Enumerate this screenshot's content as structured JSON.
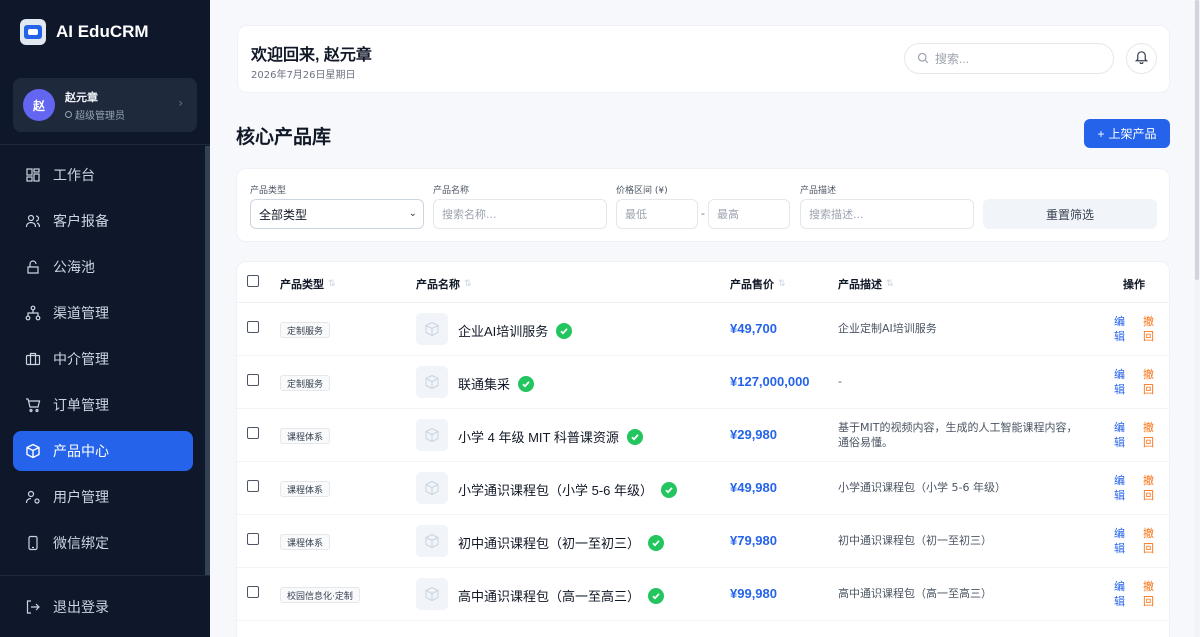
{
  "app": {
    "title": "AI EduCRM"
  },
  "user": {
    "name": "赵元章",
    "initial": "赵",
    "role": "超级管理员"
  },
  "nav": [
    {
      "label": "工作台",
      "icon": "dashboard-icon",
      "active": false
    },
    {
      "label": "客户报备",
      "icon": "users-icon",
      "active": false
    },
    {
      "label": "公海池",
      "icon": "pool-icon",
      "active": false
    },
    {
      "label": "渠道管理",
      "icon": "channel-icon",
      "active": false
    },
    {
      "label": "中介管理",
      "icon": "briefcase-icon",
      "active": false
    },
    {
      "label": "订单管理",
      "icon": "cart-icon",
      "active": false
    },
    {
      "label": "产品中心",
      "icon": "package-icon",
      "active": true
    },
    {
      "label": "用户管理",
      "icon": "user-cog-icon",
      "active": false
    },
    {
      "label": "微信绑定",
      "icon": "phone-icon",
      "active": false
    }
  ],
  "logout_label": "退出登录",
  "header": {
    "greeting": "欢迎回来, 赵元章",
    "date": "2026年7月26日星期日",
    "search_placeholder": "搜索..."
  },
  "page": {
    "title": "核心产品库",
    "add_button": "上架产品"
  },
  "filters": {
    "type_label": "产品类型",
    "type_value": "全部类型",
    "name_label": "产品名称",
    "name_placeholder": "搜索名称...",
    "price_label": "价格区间 (¥)",
    "price_min_placeholder": "最低",
    "price_max_placeholder": "最高",
    "price_sep": "-",
    "desc_label": "产品描述",
    "desc_placeholder": "搜索描述...",
    "reset": "重置筛选"
  },
  "table": {
    "columns": {
      "type": "产品类型",
      "name": "产品名称",
      "price": "产品售价",
      "desc": "产品描述",
      "actions": "操作"
    },
    "edit_label": "编辑",
    "withdraw_label": "撤回",
    "rows": [
      {
        "type": "定制服务",
        "name": "企业AI培训服务",
        "price": "¥49,700",
        "desc": "企业定制AI培训服务"
      },
      {
        "type": "定制服务",
        "name": "联通集采",
        "price": "¥127,000,000",
        "desc": "-"
      },
      {
        "type": "课程体系",
        "name": "小学 4 年级 MIT 科普课资源",
        "price": "¥29,980",
        "desc": "基于MIT的视频内容，生成的人工智能课程内容，通俗易懂。"
      },
      {
        "type": "课程体系",
        "name": "小学通识课程包（小学 5-6 年级）",
        "price": "¥49,980",
        "desc": "小学通识课程包（小学 5-6 年级）"
      },
      {
        "type": "课程体系",
        "name": "初中通识课程包（初一至初三）",
        "price": "¥79,980",
        "desc": "初中通识课程包（初一至初三）"
      },
      {
        "type": "校园信息化·定制",
        "name": "高中通识课程包（高一至高三）",
        "price": "¥99,980",
        "desc": "高中通识课程包（高一至高三）"
      }
    ]
  },
  "colors": {
    "primary": "#2563eb",
    "sidebar": "#0f172a",
    "success": "#22c55e",
    "warning": "#f97316"
  }
}
